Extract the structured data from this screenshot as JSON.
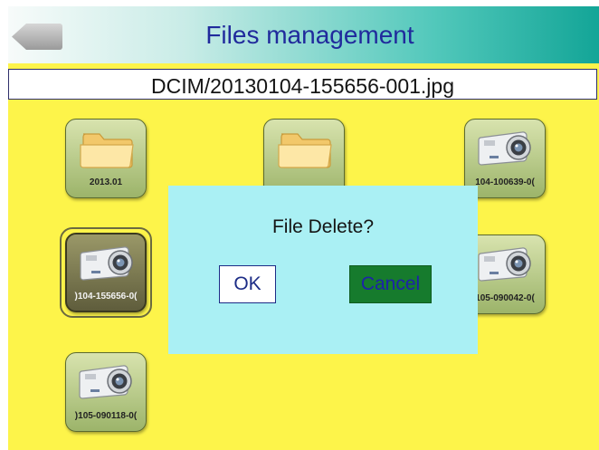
{
  "header": {
    "title": "Files management"
  },
  "path": {
    "text": "DCIM/20130104-155656-001.jpg"
  },
  "files": [
    {
      "label": "2013.01",
      "type": "folder"
    },
    {
      "label": "",
      "type": "folder"
    },
    {
      "label": "104-100639-0(",
      "type": "photo"
    },
    {
      "label": ")104-155656-0(",
      "type": "photo",
      "selected": true
    },
    {
      "label": "105-090042-0(",
      "type": "photo"
    },
    {
      "label": ")105-090118-0(",
      "type": "photo"
    }
  ],
  "dialog": {
    "message": "File Delete?",
    "ok_label": "OK",
    "cancel_label": "Cancel"
  },
  "colors": {
    "background": "#fdf44a",
    "header_end": "#13a597",
    "title_text": "#202a9c",
    "dialog_bg": "#aaf0f4",
    "cancel_bg": "#167b2d"
  }
}
